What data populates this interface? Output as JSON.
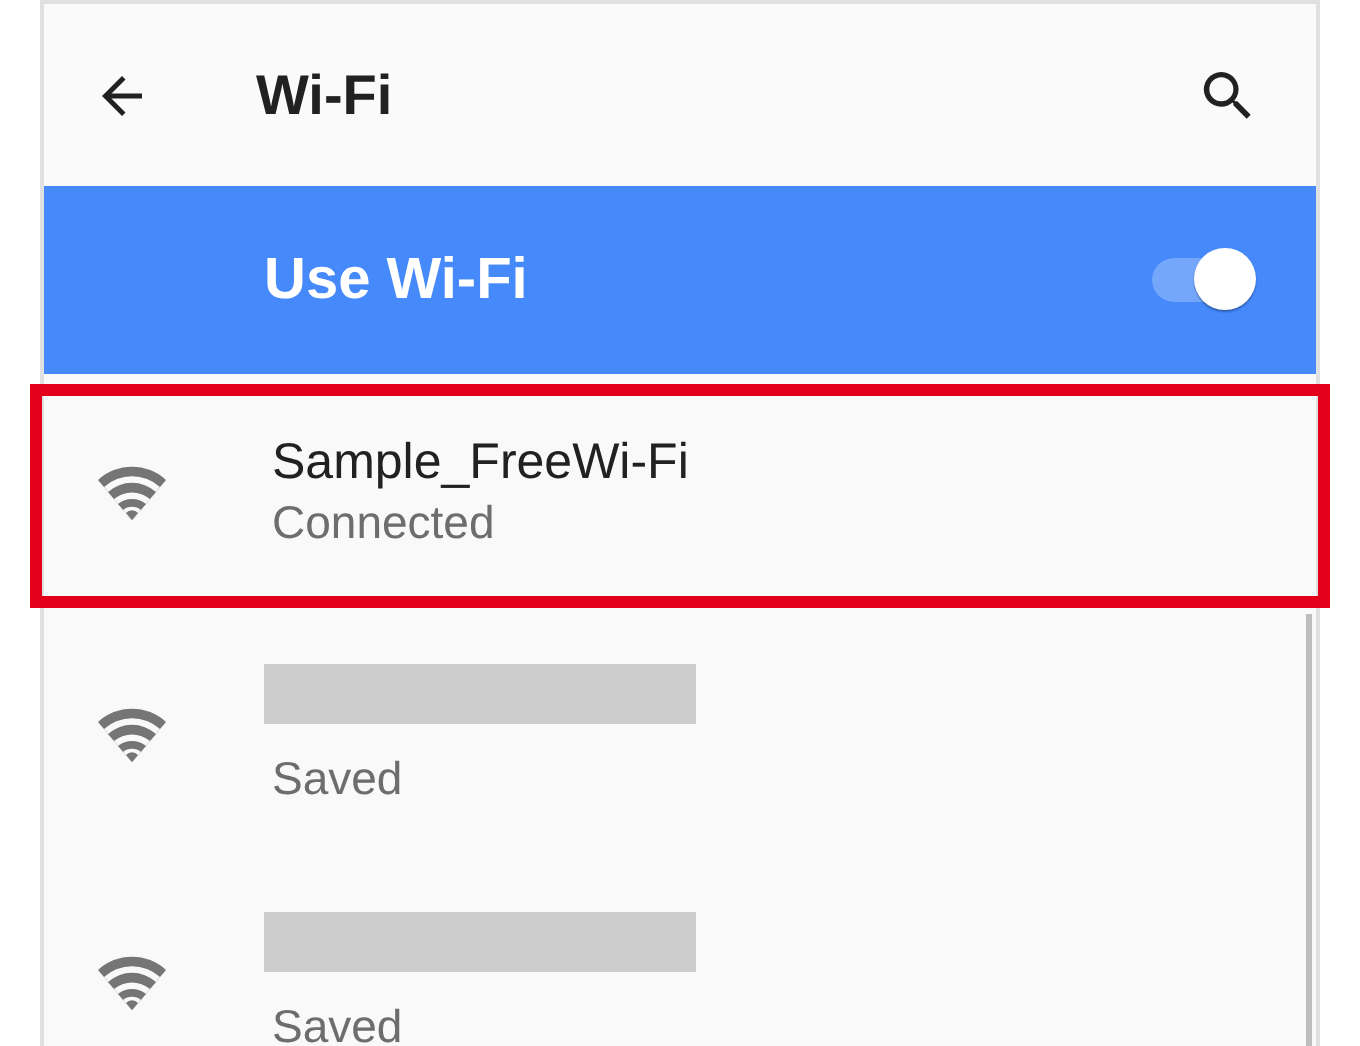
{
  "app_bar": {
    "title": "Wi-Fi"
  },
  "wifi_switch": {
    "label": "Use Wi-Fi",
    "on": true
  },
  "networks": [
    {
      "kind": "named",
      "name": "Sample_FreeWi-Fi",
      "status": "Connected",
      "highlighted": true
    },
    {
      "kind": "hidden",
      "status": "Saved",
      "highlighted": false
    },
    {
      "kind": "hidden",
      "status": "Saved",
      "highlighted": false
    }
  ]
}
